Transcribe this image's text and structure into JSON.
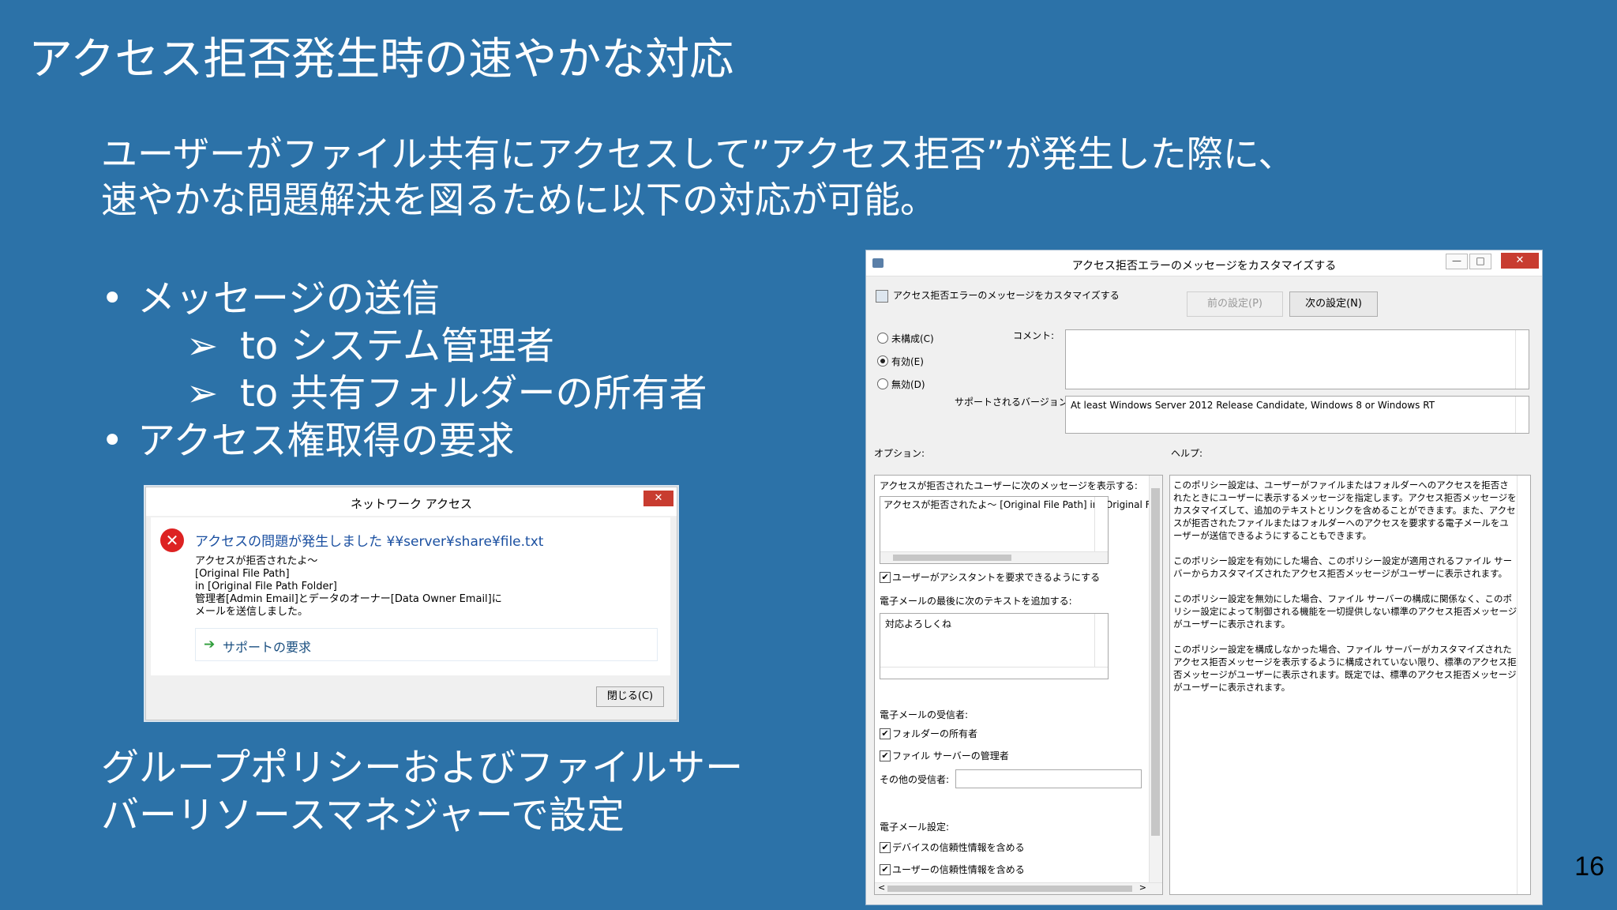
{
  "slide": {
    "title": "アクセス拒否発生時の速やかな対応",
    "lead_line1": "ユーザーがファイル共有にアクセスして”アクセス拒否”が発生した際に、",
    "lead_line2": "速やかな問題解決を図るために以下の対応が可能。",
    "bullet1": "メッセージの送信",
    "sub_arrow": "➢",
    "sub1": "to システム管理者",
    "sub2": "to 共有フォルダーの所有者",
    "bullet2": "アクセス権取得の要求",
    "footer_line1": "グループポリシーおよびファイルサー",
    "footer_line2": "バーリソースマネジャーで設定",
    "page_number": "16"
  },
  "network_dialog": {
    "title": "ネットワーク アクセス",
    "close_symbol": "✕",
    "error_icon": "error-icon",
    "error_title": "アクセスの問題が発生しました ¥¥server¥share¥file.txt",
    "message": "アクセスが拒否されたよ～\n[Original File Path]\nin [Original File Path Folder]\n管理者[Admin Email]とデータのオーナー[Data Owner Email]に\nメールを送信しました。",
    "support_arrow": "➔",
    "support_link": "サポートの要求",
    "close_button": "閉じる(C)"
  },
  "policy_dialog": {
    "title": "アクセス拒否エラーのメッセージをカスタマイズする",
    "header": "アクセス拒否エラーのメッセージをカスタマイズする",
    "prev_button": "前の設定(P)",
    "next_button": "次の設定(N)",
    "radio_not_configured": "未構成(C)",
    "radio_enabled": "有効(E)",
    "radio_disabled": "無効(D)",
    "comment_label": "コメント:",
    "supported_label": "サポートされるバージョン:",
    "supported_value": "At least Windows Server 2012 Release Candidate, Windows 8 or Windows RT",
    "options_label": "オプション:",
    "help_label": "ヘルプ:",
    "opt_message_label": "アクセスが拒否されたユーザーに次のメッセージを表示する:",
    "opt_message_value": "アクセスが拒否されたよ～\n[Original File Path]\nin [Original File Path Folder]",
    "opt_assist_label": "ユーザーがアシスタントを要求できるようにする",
    "opt_email_text_label": "電子メールの最後に次のテキストを追加する:",
    "opt_email_text_value": "対応よろしくね",
    "opt_recipients_label": "電子メールの受信者:",
    "opt_folder_owner": "フォルダーの所有者",
    "opt_fs_admin": "ファイル サーバーの管理者",
    "opt_other_recipients": "その他の受信者:",
    "opt_email_settings": "電子メール設定:",
    "opt_device_claims": "デバイスの信頼性情報を含める",
    "opt_user_claims": "ユーザーの信頼性情報を含める",
    "help_p1": "このポリシー設定は、ユーザーがファイルまたはフォルダーへのアクセスを拒否されたときにユーザーに表示するメッセージを指定します。アクセス拒否メッセージをカスタマイズして、追加のテキストとリンクを含めることができます。また、アクセスが拒否されたファイルまたはフォルダーへのアクセスを要求する電子メールをユーザーが送信できるようにすることもできます。",
    "help_p2": "このポリシー設定を有効にした場合、このポリシー設定が適用されるファイル サーバーからカスタマイズされたアクセス拒否メッセージがユーザーに表示されます。",
    "help_p3": "このポリシー設定を無効にした場合、ファイル サーバーの構成に関係なく、このポリシー設定によって制御される機能を一切提供しない標準のアクセス拒否メッセージがユーザーに表示されます。",
    "help_p4": "このポリシー設定を構成しなかった場合、ファイル サーバーがカスタマイズされたアクセス拒否メッセージを表示するように構成されていない限り、標準のアクセス拒否メッセージがユーザーに表示されます。既定では、標準のアクセス拒否メッセージがユーザーに表示されます。",
    "check_symbol": "✔",
    "min_symbol": "—",
    "max_symbol": "□",
    "close_symbol": "✕",
    "scroll_up": "▲",
    "scroll_down": "▼",
    "scroll_left": "<",
    "scroll_right": ">"
  },
  "colors": {
    "background": "#2c72a8",
    "error_red": "#dd2222",
    "link_blue": "#1a4fa0",
    "close_red": "#c83c30"
  }
}
